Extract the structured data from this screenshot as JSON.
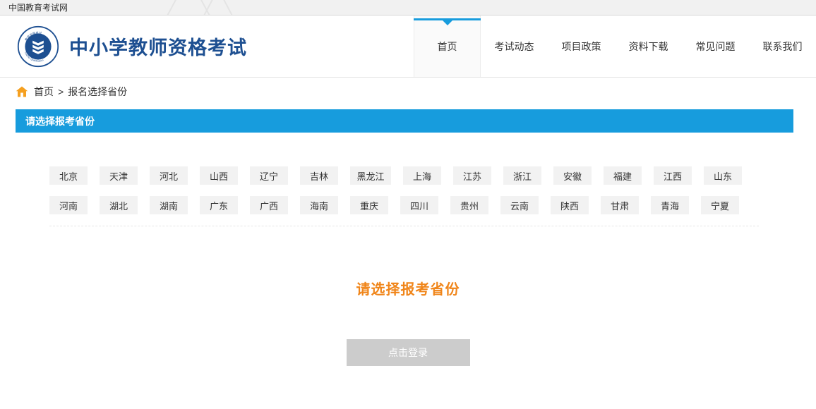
{
  "browser": {
    "tab_title": "中国教育考试网"
  },
  "header": {
    "logo_icon": "book-emblem-logo",
    "site_title": "中小学教师资格考试",
    "nav": [
      {
        "label": "首页",
        "active": true
      },
      {
        "label": "考试动态",
        "active": false
      },
      {
        "label": "项目政策",
        "active": false
      },
      {
        "label": "资料下载",
        "active": false
      },
      {
        "label": "常见问题",
        "active": false
      },
      {
        "label": "联系我们",
        "active": false
      }
    ]
  },
  "breadcrumb": {
    "home_icon": "home-icon",
    "home_label": "首页",
    "separator": ">",
    "current": "报名选择省份"
  },
  "section": {
    "title": "请选择报考省份"
  },
  "provinces": {
    "row1": [
      "北京",
      "天津",
      "河北",
      "山西",
      "辽宁",
      "吉林",
      "黑龙江",
      "上海",
      "江苏",
      "浙江",
      "安徽",
      "福建",
      "江西",
      "山东"
    ],
    "row2": [
      "河南",
      "湖北",
      "湖南",
      "广东",
      "广西",
      "海南",
      "重庆",
      "四川",
      "贵州",
      "云南",
      "陕西",
      "甘肃",
      "青海",
      "宁夏"
    ]
  },
  "notice": {
    "text": "请选择报考省份"
  },
  "login": {
    "label": "点击登录"
  },
  "colors": {
    "accent_blue": "#179cdd",
    "brand_blue": "#1d4f91",
    "notice_orange": "#f08519",
    "button_gray": "#cccccc",
    "chip_gray": "#f2f2f2"
  }
}
